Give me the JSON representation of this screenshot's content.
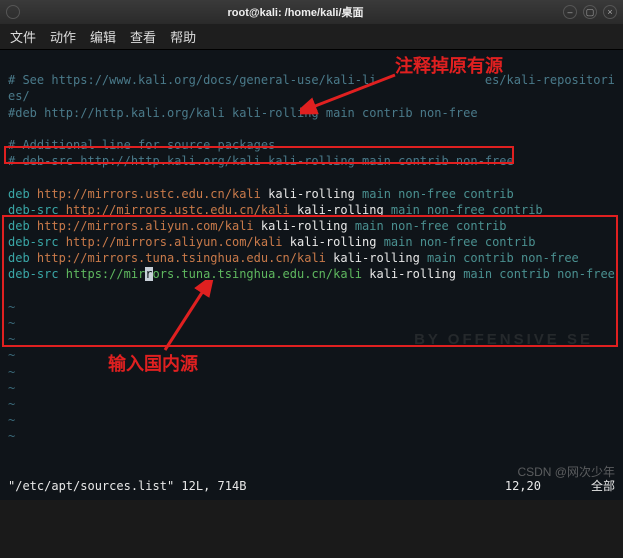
{
  "titlebar": {
    "title": "root@kali: /home/kali/桌面"
  },
  "menu": {
    "file": "文件",
    "actions": "动作",
    "edit": "编辑",
    "view": "查看",
    "help": "帮助"
  },
  "lines": {
    "l1a": "# See https://www.kali.org/docs/general-use/kali-li",
    "l1b": "es/kali-repositories/",
    "l2": "#deb http://http.kali.org/kali kali-rolling main contrib non-free",
    "l3": "# Additional line for source packages",
    "l4": "# deb-src http://http.kali.org/kali kali-rolling main contrib non-free",
    "d1_kw": "deb ",
    "d1_url": "http://mirrors.ustc.edu.cn/kali",
    "d1_rel": " kali-rolling ",
    "d1_p": "main non-free contrib",
    "d2_kw": "deb-src ",
    "d2_url": "http://mirrors.ustc.edu.cn/kali",
    "d2_rel": " kali-rolling ",
    "d2_p": "main non-free contrib",
    "d3_kw": "deb ",
    "d3_url": "http://mirrors.aliyun.com/kali",
    "d3_rel": " kali-rolling ",
    "d3_p": "main non-free contrib",
    "d4_kw": "deb-src ",
    "d4_url": "http://mirrors.aliyun.com/kali",
    "d4_rel": " kali-rolling ",
    "d4_p": "main non-free contrib",
    "d5_kw": "deb ",
    "d5_url": "http://mirrors.tuna.tsinghua.edu.cn/kali",
    "d5_rel": " kali-rolling ",
    "d5_p": "main contrib non-free",
    "d6_kw": "deb-src ",
    "d6_url_a": "https://mir",
    "d6_url_cursor": "r",
    "d6_url_b": "ors.tuna.tsinghua.edu.cn/kali",
    "d6_rel": " kali-rolling ",
    "d6_p": "main contrib non-free",
    "tilde": "~"
  },
  "annotations": {
    "a1": "注释掉原有源",
    "a2": "输入国内源"
  },
  "status": {
    "file": "\"/etc/apt/sources.list\" 12L, 714B",
    "pos": "12,20",
    "mode": "全部"
  },
  "watermark": "CSDN @网次少年",
  "bg_logo": "BY OFFENSIVE SE"
}
